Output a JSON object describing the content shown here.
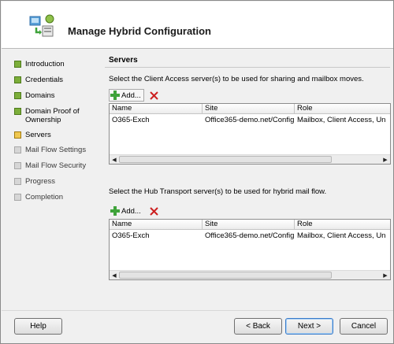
{
  "header": {
    "title": "Manage Hybrid Configuration",
    "icon": "hybrid-config-icon"
  },
  "steps": [
    {
      "label": "Introduction",
      "status": "done"
    },
    {
      "label": "Credentials",
      "status": "done"
    },
    {
      "label": "Domains",
      "status": "done"
    },
    {
      "label": "Domain Proof of Ownership",
      "status": "done"
    },
    {
      "label": "Servers",
      "status": "current"
    },
    {
      "label": "Mail Flow Settings",
      "status": "pending"
    },
    {
      "label": "Mail Flow Security",
      "status": "pending"
    },
    {
      "label": "Progress",
      "status": "pending"
    },
    {
      "label": "Completion",
      "status": "pending"
    }
  ],
  "main": {
    "section_title": "Servers",
    "cas": {
      "instruction": "Select the Client Access server(s) to be used for sharing and mailbox moves.",
      "add_label": "Add...",
      "columns": [
        "Name",
        "Site",
        "Role"
      ],
      "rows": [
        {
          "name": "O365-Exch",
          "site": "Office365-demo.net/Config...",
          "role": "Mailbox, Client Access, Un"
        }
      ]
    },
    "hub": {
      "instruction": "Select the Hub Transport server(s) to be used for hybrid mail flow.",
      "add_label": "Add...",
      "columns": [
        "Name",
        "Site",
        "Role"
      ],
      "rows": [
        {
          "name": "O365-Exch",
          "site": "Office365-demo.net/Config...",
          "role": "Mailbox, Client Access, Un"
        }
      ]
    }
  },
  "footer": {
    "help": "Help",
    "back": "Back",
    "next": "Next >",
    "cancel": "Cancel"
  },
  "colors": {
    "done": "#7cae3a",
    "current": "#f0c850",
    "pending": "#d6d6d6",
    "delete": "#cc1f1f",
    "add": "#3fa33a"
  }
}
